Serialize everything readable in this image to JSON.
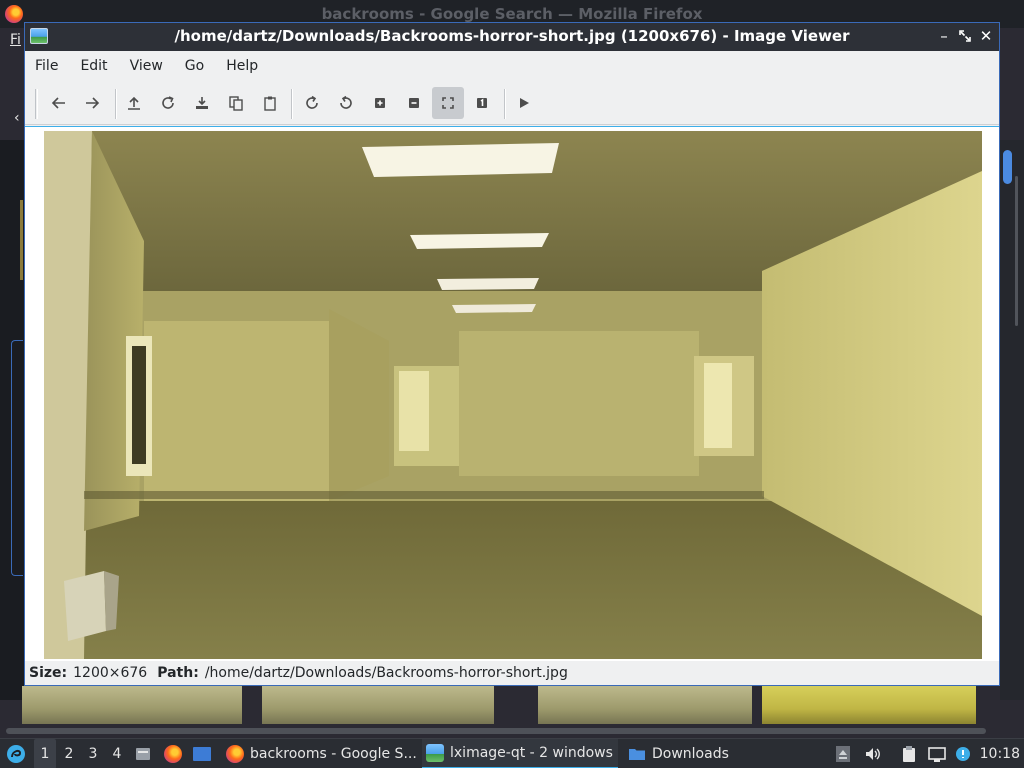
{
  "background_window": {
    "title": "backrooms - Google Search — Mozilla Firefox",
    "menu_fragment": "Fi",
    "back_glyph": "‹"
  },
  "viewer": {
    "title": "/home/dartz/Downloads/Backrooms-horror-short.jpg (1200x676) - Image Viewer",
    "menu": [
      "File",
      "Edit",
      "View",
      "Go",
      "Help"
    ],
    "toolbar": [
      {
        "name": "back-icon",
        "active": false
      },
      {
        "name": "forward-icon",
        "active": false
      },
      {
        "name": "upload-icon",
        "active": false
      },
      {
        "name": "reload-icon",
        "active": false
      },
      {
        "name": "save-icon",
        "active": false
      },
      {
        "name": "copy-icon",
        "active": false
      },
      {
        "name": "paste-icon",
        "active": false
      },
      {
        "name": "rotate-clockwise-icon",
        "active": false
      },
      {
        "name": "rotate-counterclockwise-icon",
        "active": false
      },
      {
        "name": "zoom-in-icon",
        "active": false
      },
      {
        "name": "zoom-out-icon",
        "active": false
      },
      {
        "name": "zoom-fit-icon",
        "active": true
      },
      {
        "name": "original-size-icon",
        "active": false
      },
      {
        "name": "slideshow-icon",
        "active": false
      }
    ],
    "status": {
      "size_label": "Size:",
      "size_value": "1200×676",
      "path_label": "Path:",
      "path_value": "/home/dartz/Downloads/Backrooms-horror-short.jpg"
    }
  },
  "taskbar": {
    "workspaces": [
      "1",
      "2",
      "3",
      "4"
    ],
    "active_workspace": "1",
    "tasks": [
      {
        "label": "backrooms - Google S...",
        "icon": "firefox-icon",
        "active": false
      },
      {
        "label": "lximage-qt - 2 windows",
        "icon": "image-viewer-icon",
        "active": true
      },
      {
        "label": "Downloads",
        "icon": "folder-icon",
        "active": false
      }
    ],
    "clock": "10:18"
  },
  "colors": {
    "accent": "#3daee9",
    "titlebar": "#2d3037",
    "wall": "#b8ad6a"
  }
}
